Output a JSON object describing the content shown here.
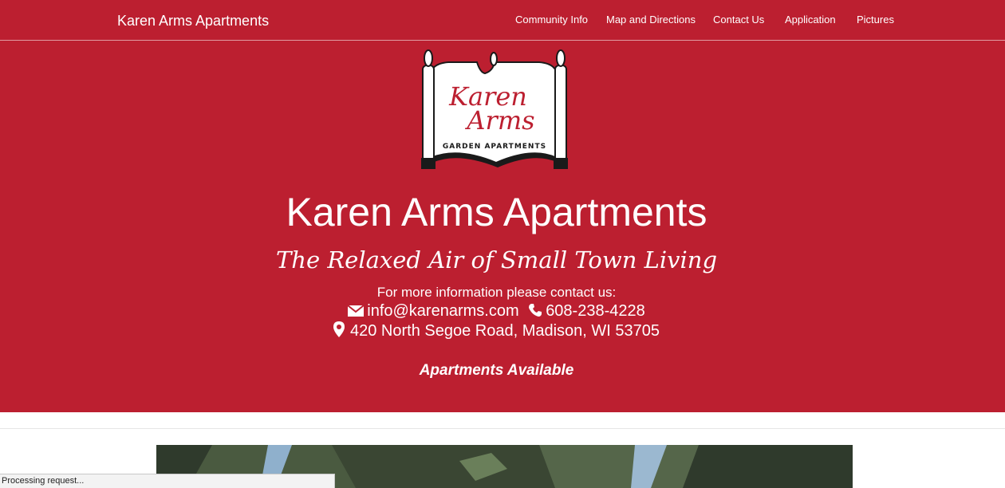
{
  "navbar": {
    "brand": "Karen Arms Apartments",
    "links": [
      {
        "label": "Community Info"
      },
      {
        "label": "Map and Directions"
      },
      {
        "label": "Contact Us"
      },
      {
        "label": "Application"
      },
      {
        "label": "Pictures"
      }
    ]
  },
  "logo": {
    "line1": "Karen",
    "line2": "Arms",
    "subtitle": "GARDEN APARTMENTS"
  },
  "hero": {
    "title": "Karen Arms Apartments",
    "tagline": "The Relaxed Air of Small Town Living",
    "contact_prompt": "For more information please contact us:",
    "email": "info@karenarms.com",
    "phone": "608-238-4228",
    "address": "420 North Segoe Road, Madison, WI 53705",
    "availability": "Apartments Available"
  },
  "status_bar": {
    "text": "Processing request..."
  },
  "colors": {
    "brand_red": "#bc1f30",
    "text_on_brand": "#ffffff"
  },
  "icons": {
    "email": "envelope-icon",
    "phone": "phone-icon",
    "address": "map-marker-icon"
  }
}
